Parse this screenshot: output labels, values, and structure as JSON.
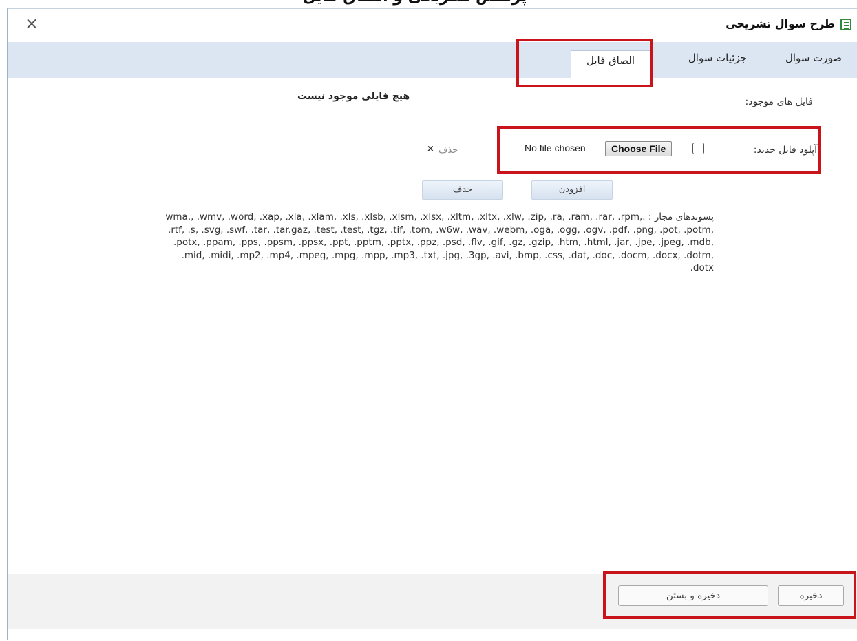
{
  "window": {
    "caption_partial": "پرسش تشریحی و الصاق فایل",
    "title": "طرح سوال تشریحی",
    "close_glyph": "×"
  },
  "tabs": [
    {
      "label": "صورت سوال",
      "active": false
    },
    {
      "label": "جزئیات سوال",
      "active": false
    },
    {
      "label": "الصاق فایل",
      "active": true
    }
  ],
  "files": {
    "existing_label": "فایل های موجود:",
    "empty_message": "هیچ فایلی موجود نیست"
  },
  "upload": {
    "label": "آپلود فایل جدید:",
    "choose_label": "Choose File",
    "no_file_text": "No file chosen",
    "delete_label": "حذف",
    "delete_glyph": "×"
  },
  "actions": {
    "add_label": "افزودن",
    "delete_label": "حذف"
  },
  "allowed": {
    "text": "پسوندهای مجاز : .wma., .wmv, .word, .xap, .xla, .xlam, .xls, .xlsb, .xlsm, .xlsx, .xltm, .xltx, .xlw, .zip, .ra, .ram, .rar, .rpm, .rtf, .s, .svg, .swf, .tar, .tar.gaz, .test, .test, .tgz, .tif, .tom, .w6w, .wav, .webm, .oga, .ogg, .ogv, .pdf, .png, .pot, .potm, .potx, .ppam, .pps, .ppsm, .ppsx, .ppt, .pptm, .pptx, .ppz, .psd, .flv, .gif, .gz, .gzip, .htm, .html, .jar, .jpe, .jpeg, .mdb, .mid, .midi, .mp2, .mp4, .mpeg, .mpg, .mpp, .mp3, .txt, .jpg, .3gp, .avi, .bmp, .css, .dat, .doc, .docm, .docx, .dotm, .dotx"
  },
  "footer": {
    "save_label": "ذخیره",
    "save_close_label": "ذخیره و بستن"
  },
  "colors": {
    "highlight": "#c8141a",
    "tabbar": "#dce6f2"
  }
}
